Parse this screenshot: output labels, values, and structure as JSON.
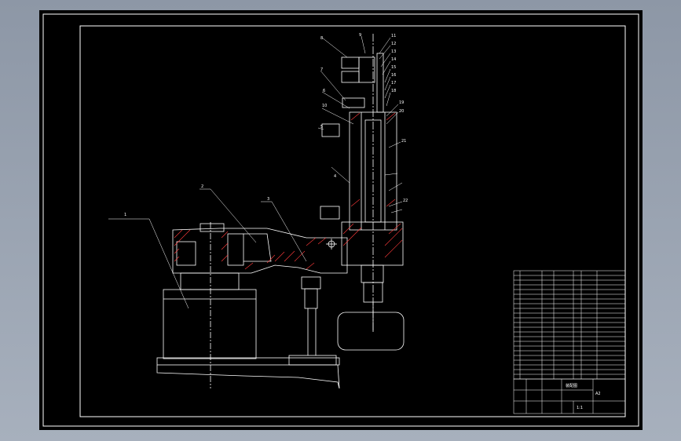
{
  "colors": {
    "background": "#000000",
    "line": "#ffffff",
    "hatch": "#ff3b3b",
    "centerline": "#ffffff",
    "outer_bg": "#9aa4b2"
  },
  "part_labels": [
    {
      "id": "lbl-1",
      "text": "1"
    },
    {
      "id": "lbl-2",
      "text": "2"
    },
    {
      "id": "lbl-3",
      "text": "3"
    },
    {
      "id": "lbl-4",
      "text": "4"
    },
    {
      "id": "lbl-5",
      "text": "5"
    },
    {
      "id": "lbl-6",
      "text": "6"
    },
    {
      "id": "lbl-7",
      "text": "7"
    },
    {
      "id": "lbl-8",
      "text": "8"
    },
    {
      "id": "lbl-9",
      "text": "9"
    },
    {
      "id": "lbl-10",
      "text": "10"
    },
    {
      "id": "lbl-11",
      "text": "11"
    },
    {
      "id": "lbl-12",
      "text": "12"
    },
    {
      "id": "lbl-13",
      "text": "13"
    },
    {
      "id": "lbl-14",
      "text": "14"
    },
    {
      "id": "lbl-15",
      "text": "15"
    },
    {
      "id": "lbl-16",
      "text": "16"
    },
    {
      "id": "lbl-17",
      "text": "17"
    },
    {
      "id": "lbl-18",
      "text": "18"
    },
    {
      "id": "lbl-19",
      "text": "19"
    },
    {
      "id": "lbl-20",
      "text": "20"
    },
    {
      "id": "lbl-21",
      "text": "21"
    },
    {
      "id": "lbl-22",
      "text": "22"
    }
  ],
  "title_block": {
    "drawing_title": "装配图",
    "scale": "1:1",
    "sheet_ref": "A2"
  }
}
